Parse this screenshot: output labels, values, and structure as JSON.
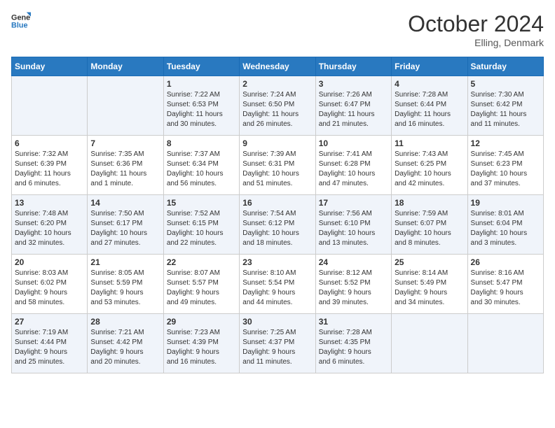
{
  "logo": {
    "line1": "General",
    "line2": "Blue"
  },
  "title": "October 2024",
  "subtitle": "Elling, Denmark",
  "days_header": [
    "Sunday",
    "Monday",
    "Tuesday",
    "Wednesday",
    "Thursday",
    "Friday",
    "Saturday"
  ],
  "weeks": [
    [
      {
        "num": "",
        "info": ""
      },
      {
        "num": "",
        "info": ""
      },
      {
        "num": "1",
        "info": "Sunrise: 7:22 AM\nSunset: 6:53 PM\nDaylight: 11 hours\nand 30 minutes."
      },
      {
        "num": "2",
        "info": "Sunrise: 7:24 AM\nSunset: 6:50 PM\nDaylight: 11 hours\nand 26 minutes."
      },
      {
        "num": "3",
        "info": "Sunrise: 7:26 AM\nSunset: 6:47 PM\nDaylight: 11 hours\nand 21 minutes."
      },
      {
        "num": "4",
        "info": "Sunrise: 7:28 AM\nSunset: 6:44 PM\nDaylight: 11 hours\nand 16 minutes."
      },
      {
        "num": "5",
        "info": "Sunrise: 7:30 AM\nSunset: 6:42 PM\nDaylight: 11 hours\nand 11 minutes."
      }
    ],
    [
      {
        "num": "6",
        "info": "Sunrise: 7:32 AM\nSunset: 6:39 PM\nDaylight: 11 hours\nand 6 minutes."
      },
      {
        "num": "7",
        "info": "Sunrise: 7:35 AM\nSunset: 6:36 PM\nDaylight: 11 hours\nand 1 minute."
      },
      {
        "num": "8",
        "info": "Sunrise: 7:37 AM\nSunset: 6:34 PM\nDaylight: 10 hours\nand 56 minutes."
      },
      {
        "num": "9",
        "info": "Sunrise: 7:39 AM\nSunset: 6:31 PM\nDaylight: 10 hours\nand 51 minutes."
      },
      {
        "num": "10",
        "info": "Sunrise: 7:41 AM\nSunset: 6:28 PM\nDaylight: 10 hours\nand 47 minutes."
      },
      {
        "num": "11",
        "info": "Sunrise: 7:43 AM\nSunset: 6:25 PM\nDaylight: 10 hours\nand 42 minutes."
      },
      {
        "num": "12",
        "info": "Sunrise: 7:45 AM\nSunset: 6:23 PM\nDaylight: 10 hours\nand 37 minutes."
      }
    ],
    [
      {
        "num": "13",
        "info": "Sunrise: 7:48 AM\nSunset: 6:20 PM\nDaylight: 10 hours\nand 32 minutes."
      },
      {
        "num": "14",
        "info": "Sunrise: 7:50 AM\nSunset: 6:17 PM\nDaylight: 10 hours\nand 27 minutes."
      },
      {
        "num": "15",
        "info": "Sunrise: 7:52 AM\nSunset: 6:15 PM\nDaylight: 10 hours\nand 22 minutes."
      },
      {
        "num": "16",
        "info": "Sunrise: 7:54 AM\nSunset: 6:12 PM\nDaylight: 10 hours\nand 18 minutes."
      },
      {
        "num": "17",
        "info": "Sunrise: 7:56 AM\nSunset: 6:10 PM\nDaylight: 10 hours\nand 13 minutes."
      },
      {
        "num": "18",
        "info": "Sunrise: 7:59 AM\nSunset: 6:07 PM\nDaylight: 10 hours\nand 8 minutes."
      },
      {
        "num": "19",
        "info": "Sunrise: 8:01 AM\nSunset: 6:04 PM\nDaylight: 10 hours\nand 3 minutes."
      }
    ],
    [
      {
        "num": "20",
        "info": "Sunrise: 8:03 AM\nSunset: 6:02 PM\nDaylight: 9 hours\nand 58 minutes."
      },
      {
        "num": "21",
        "info": "Sunrise: 8:05 AM\nSunset: 5:59 PM\nDaylight: 9 hours\nand 53 minutes."
      },
      {
        "num": "22",
        "info": "Sunrise: 8:07 AM\nSunset: 5:57 PM\nDaylight: 9 hours\nand 49 minutes."
      },
      {
        "num": "23",
        "info": "Sunrise: 8:10 AM\nSunset: 5:54 PM\nDaylight: 9 hours\nand 44 minutes."
      },
      {
        "num": "24",
        "info": "Sunrise: 8:12 AM\nSunset: 5:52 PM\nDaylight: 9 hours\nand 39 minutes."
      },
      {
        "num": "25",
        "info": "Sunrise: 8:14 AM\nSunset: 5:49 PM\nDaylight: 9 hours\nand 34 minutes."
      },
      {
        "num": "26",
        "info": "Sunrise: 8:16 AM\nSunset: 5:47 PM\nDaylight: 9 hours\nand 30 minutes."
      }
    ],
    [
      {
        "num": "27",
        "info": "Sunrise: 7:19 AM\nSunset: 4:44 PM\nDaylight: 9 hours\nand 25 minutes."
      },
      {
        "num": "28",
        "info": "Sunrise: 7:21 AM\nSunset: 4:42 PM\nDaylight: 9 hours\nand 20 minutes."
      },
      {
        "num": "29",
        "info": "Sunrise: 7:23 AM\nSunset: 4:39 PM\nDaylight: 9 hours\nand 16 minutes."
      },
      {
        "num": "30",
        "info": "Sunrise: 7:25 AM\nSunset: 4:37 PM\nDaylight: 9 hours\nand 11 minutes."
      },
      {
        "num": "31",
        "info": "Sunrise: 7:28 AM\nSunset: 4:35 PM\nDaylight: 9 hours\nand 6 minutes."
      },
      {
        "num": "",
        "info": ""
      },
      {
        "num": "",
        "info": ""
      }
    ]
  ]
}
